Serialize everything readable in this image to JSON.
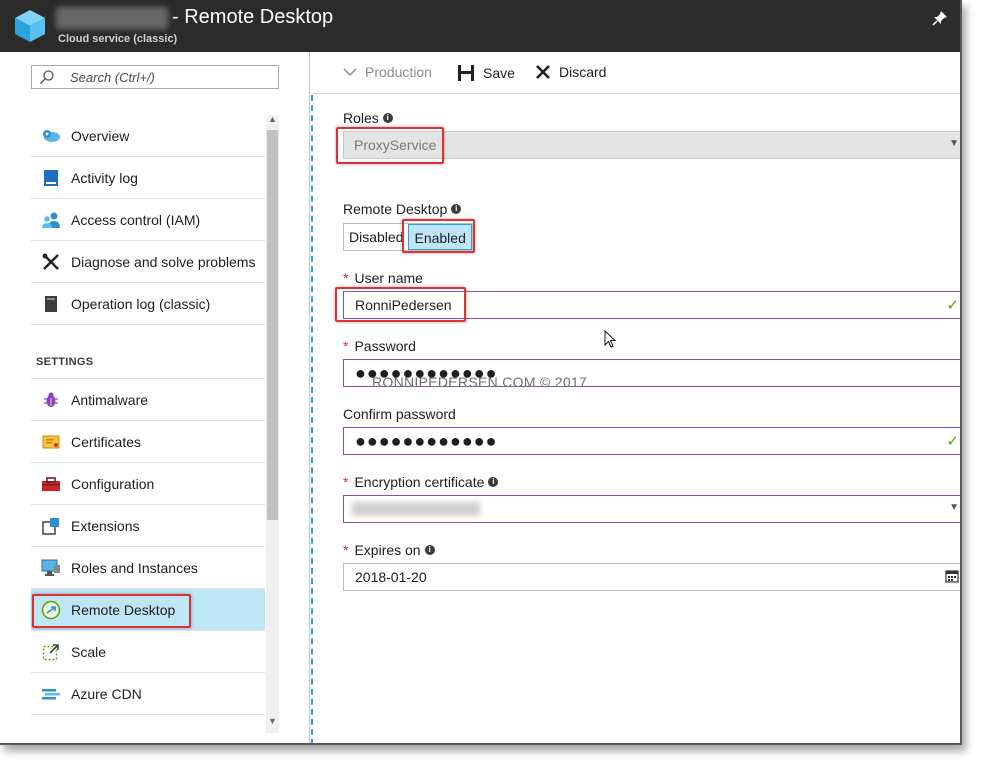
{
  "header": {
    "title": "- Remote Desktop",
    "subtitle": "Cloud service (classic)"
  },
  "sidebar": {
    "search_placeholder": "Search (Ctrl+/)",
    "items": [
      {
        "label": "Overview",
        "icon": "cloud-gear-icon"
      },
      {
        "label": "Activity log",
        "icon": "log-book-icon"
      },
      {
        "label": "Access control (IAM)",
        "icon": "users-icon"
      },
      {
        "label": "Diagnose and solve problems",
        "icon": "tools-icon"
      },
      {
        "label": "Operation log (classic)",
        "icon": "document-icon"
      }
    ],
    "settings_header": "SETTINGS",
    "settings_items": [
      {
        "label": "Antimalware",
        "icon": "bug-icon"
      },
      {
        "label": "Certificates",
        "icon": "certificate-icon"
      },
      {
        "label": "Configuration",
        "icon": "toolbox-icon"
      },
      {
        "label": "Extensions",
        "icon": "puzzle-icon"
      },
      {
        "label": "Roles and Instances",
        "icon": "monitor-icon"
      },
      {
        "label": "Remote Desktop",
        "icon": "remote-desktop-icon"
      },
      {
        "label": "Scale",
        "icon": "scale-icon"
      },
      {
        "label": "Azure CDN",
        "icon": "cdn-icon"
      }
    ],
    "active_item": "Remote Desktop"
  },
  "toolbar": {
    "production_label": "Production",
    "save_label": "Save",
    "discard_label": "Discard"
  },
  "form": {
    "roles_label": "Roles",
    "roles_value": "ProxyService",
    "remote_desktop_label": "Remote Desktop",
    "toggle_disabled": "Disabled",
    "toggle_enabled": "Enabled",
    "toggle_selected": "Enabled",
    "username_label": "User name",
    "username_value": "RonniPedersen",
    "password_label": "Password",
    "password_value": "●●●●●●●●●●●●",
    "confirm_label": "Confirm password",
    "confirm_value": "●●●●●●●●●●●●",
    "cert_label": "Encryption certificate",
    "expires_label": "Expires on",
    "expires_value": "2018-01-20"
  },
  "watermark": "RONNIPEDERSEN.COM © 2017",
  "colors": {
    "header_bg": "#2b2b2b",
    "active_bg": "#bfe6f7",
    "accent": "#2f9fd8",
    "highlight": "#e03131",
    "valid": "#57a300",
    "input_border": "#8a4fb3"
  }
}
